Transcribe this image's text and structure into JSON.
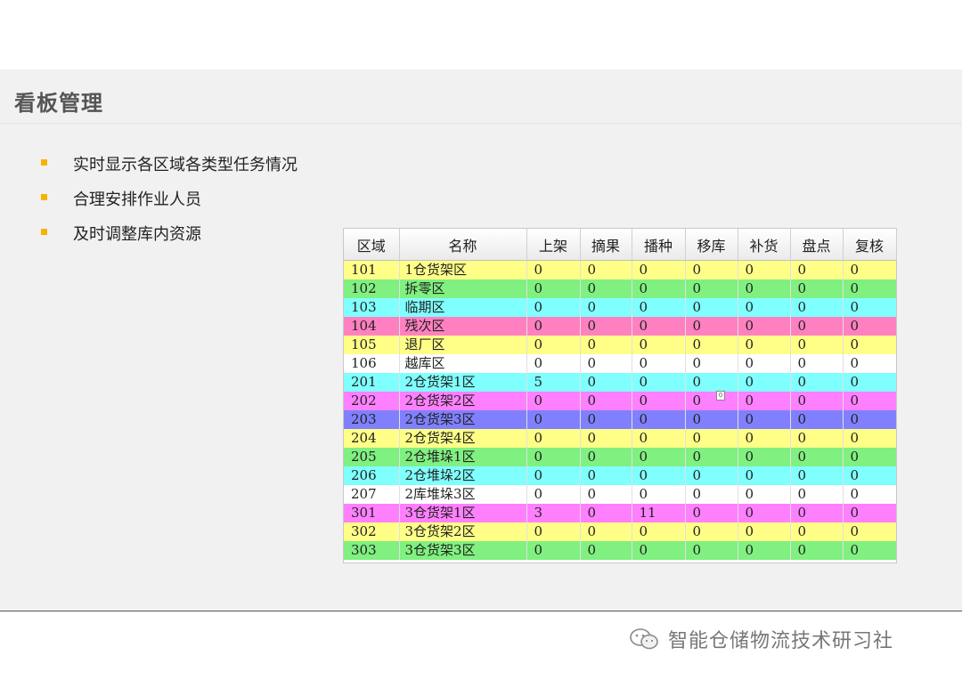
{
  "slide": {
    "title": "看板管理",
    "bullets": [
      "实时显示各区域各类型任务情况",
      "合理安排作业人员",
      "及时调整库内资源"
    ]
  },
  "table": {
    "headers": [
      "区域",
      "名称",
      "上架",
      "摘果",
      "播种",
      "移库",
      "补货",
      "盘点",
      "复核"
    ],
    "rows": [
      {
        "cells": [
          "101",
          "1仓货架区",
          "0",
          "0",
          "0",
          "0",
          "0",
          "0",
          "0"
        ],
        "color": "#ffff88"
      },
      {
        "cells": [
          "102",
          "拆零区",
          "0",
          "0",
          "0",
          "0",
          "0",
          "0",
          "0"
        ],
        "color": "#80f080"
      },
      {
        "cells": [
          "103",
          "临期区",
          "0",
          "0",
          "0",
          "0",
          "0",
          "0",
          "0"
        ],
        "color": "#80ffff"
      },
      {
        "cells": [
          "104",
          "残次区",
          "0",
          "0",
          "0",
          "0",
          "0",
          "0",
          "0"
        ],
        "color": "#ff80c0"
      },
      {
        "cells": [
          "105",
          "退厂区",
          "0",
          "0",
          "0",
          "0",
          "0",
          "0",
          "0"
        ],
        "color": "#ffff88"
      },
      {
        "cells": [
          "106",
          "越库区",
          "0",
          "0",
          "0",
          "0",
          "0",
          "0",
          "0"
        ],
        "color": "#ffffff"
      },
      {
        "cells": [
          "201",
          "2仓货架1区",
          "5",
          "0",
          "0",
          "0",
          "0",
          "0",
          "0"
        ],
        "color": "#80ffff"
      },
      {
        "cells": [
          "202",
          "2仓货架2区",
          "0",
          "0",
          "0",
          "0",
          "0",
          "0",
          "0"
        ],
        "color": "#ff80ff"
      },
      {
        "cells": [
          "203",
          "2仓货架3区",
          "0",
          "0",
          "0",
          "0",
          "0",
          "0",
          "0"
        ],
        "color": "#8080ff"
      },
      {
        "cells": [
          "204",
          "2仓货架4区",
          "0",
          "0",
          "0",
          "0",
          "0",
          "0",
          "0"
        ],
        "color": "#ffff88"
      },
      {
        "cells": [
          "205",
          "2仓堆垛1区",
          "0",
          "0",
          "0",
          "0",
          "0",
          "0",
          "0"
        ],
        "color": "#80f080"
      },
      {
        "cells": [
          "206",
          "2仓堆垛2区",
          "0",
          "0",
          "0",
          "0",
          "0",
          "0",
          "0"
        ],
        "color": "#80ffff"
      },
      {
        "cells": [
          "207",
          "2库堆垛3区",
          "0",
          "0",
          "0",
          "0",
          "0",
          "0",
          "0"
        ],
        "color": "#ffffff"
      },
      {
        "cells": [
          "301",
          "3仓货架1区",
          "3",
          "0",
          "11",
          "0",
          "0",
          "0",
          "0"
        ],
        "color": "#ff80ff"
      },
      {
        "cells": [
          "302",
          "3仓货架2区",
          "0",
          "0",
          "0",
          "0",
          "0",
          "0",
          "0"
        ],
        "color": "#ffff88"
      },
      {
        "cells": [
          "303",
          "3仓货架3区",
          "0",
          "0",
          "0",
          "0",
          "0",
          "0",
          "0"
        ],
        "color": "#80f080"
      }
    ],
    "marker": "0"
  },
  "footer": {
    "brand": "智能仓储物流技术研习社",
    "icon": "wechat-icon"
  },
  "colors": {
    "bullet": "#f5b400",
    "title": "#555555",
    "slide_bg": "#f1f1f1"
  }
}
